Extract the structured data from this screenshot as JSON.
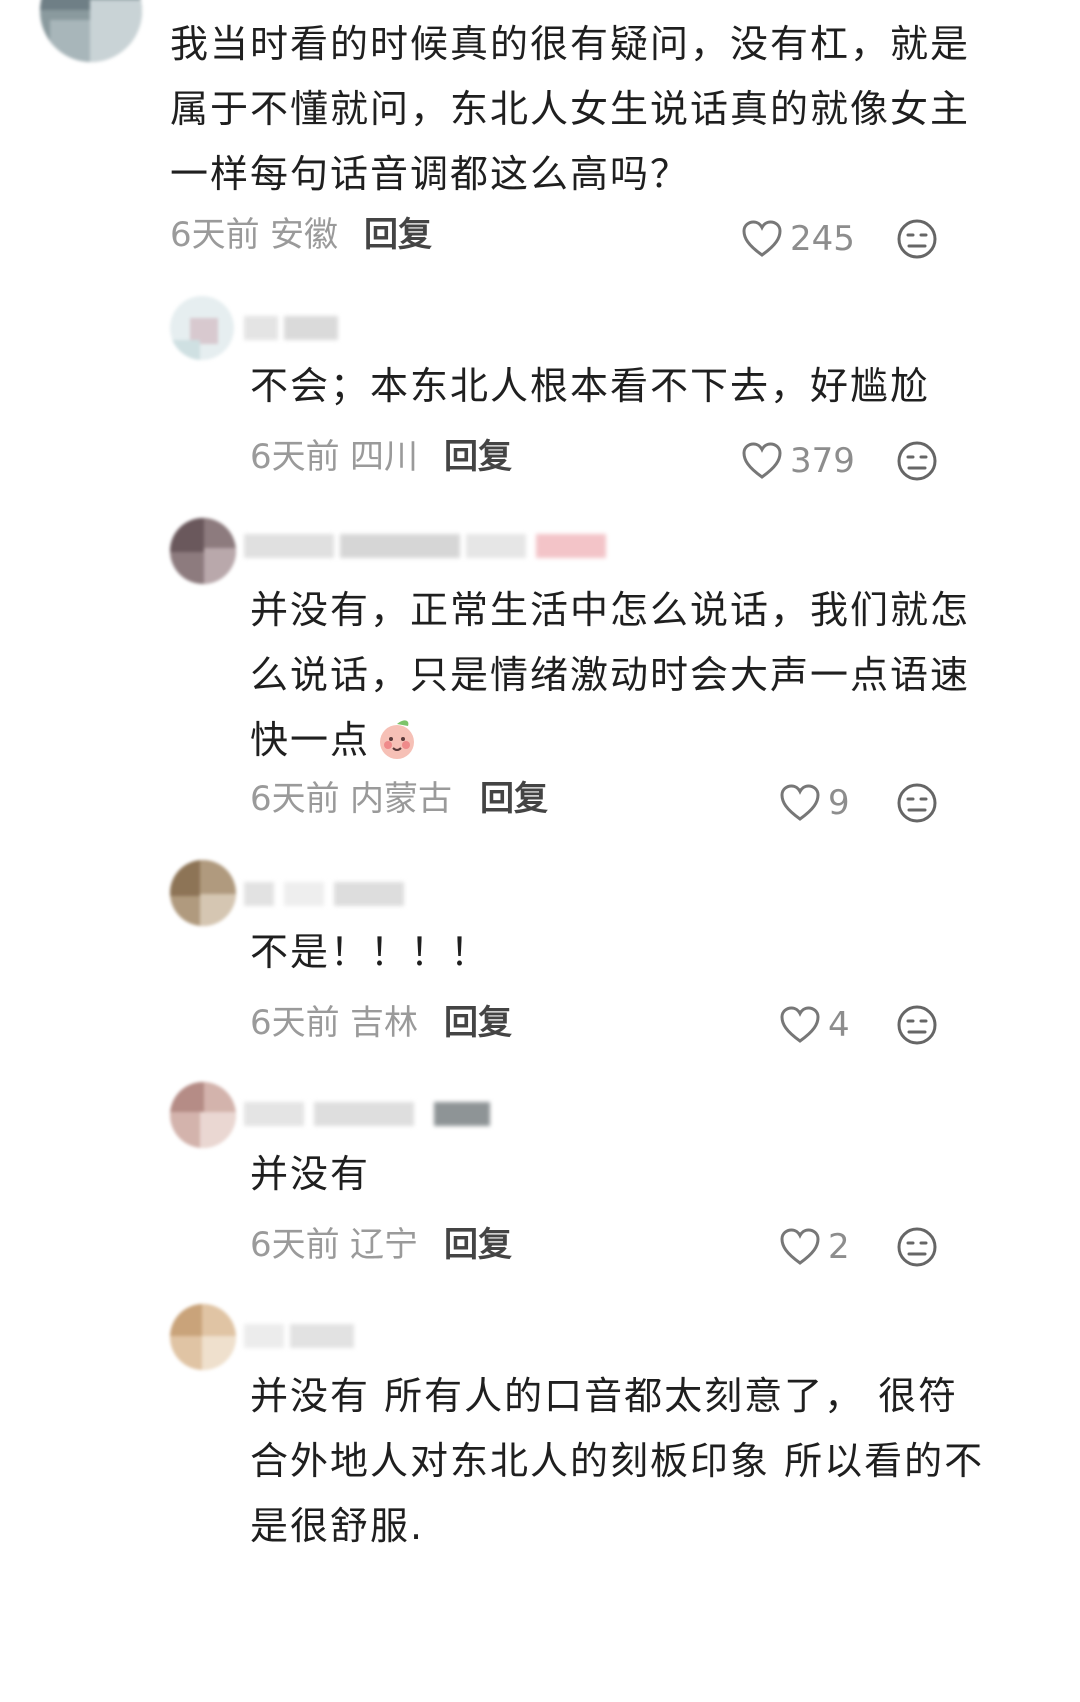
{
  "comments": [
    {
      "text_lines": [
        "我当时看的时候真的很有疑问，没有杠，就是",
        "属于不懂就问，东北人女生说话真的就像女主",
        "一样每句话音调都这么高吗？"
      ],
      "time": "6天前",
      "location": "安徽",
      "reply_label": "回复",
      "likes": "245"
    },
    {
      "text_lines": [
        "不会；本东北人根本看不下去，好尴尬"
      ],
      "time": "6天前",
      "location": "四川",
      "reply_label": "回复",
      "likes": "379"
    },
    {
      "text_lines": [
        "并没有，正常生活中怎么说话，我们就怎",
        "么说话，只是情绪激动时会大声一点语速",
        "快一点"
      ],
      "time": "6天前",
      "location": "内蒙古",
      "reply_label": "回复",
      "likes": "9"
    },
    {
      "text_lines": [
        "不是！！！！"
      ],
      "time": "6天前",
      "location": "吉林",
      "reply_label": "回复",
      "likes": "4"
    },
    {
      "text_lines": [
        "并没有"
      ],
      "time": "6天前",
      "location": "辽宁",
      "reply_label": "回复",
      "likes": "2"
    },
    {
      "text_lines": [
        "并没有 所有人的口音都太刻意了， 很符",
        "合外地人对东北人的刻板印象 所以看的不",
        "是很舒服."
      ]
    }
  ],
  "icons": {
    "like": "heart-outline-icon",
    "dislike": "neutral-face-icon",
    "emoji": "blushing-peach-emoji"
  },
  "colors": {
    "text": "#1f1f1f",
    "meta": "#9a9a9a",
    "reply": "#444444"
  }
}
